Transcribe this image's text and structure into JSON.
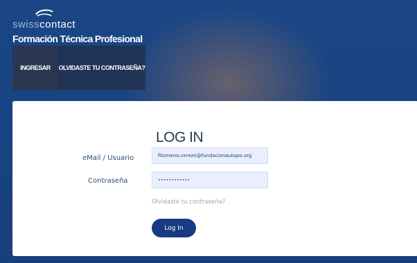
{
  "brand": {
    "logo_light": "swiss",
    "logo_bold": "contact",
    "subtitle": "Formación Técnica Profesional"
  },
  "nav": {
    "items": [
      {
        "label": "INGRESAR"
      },
      {
        "label": "OLVIDASTE TU CONTRASEÑA?"
      }
    ]
  },
  "login": {
    "title": "LOG IN",
    "email_label": "eMail / Usuario",
    "email_value": "filomeno.cerezo@fundacionautapo.org",
    "password_label": "Contraseña",
    "password_value": "••••••••••••",
    "forgot_link": "Olvidaste tu contraseña?",
    "submit_label": "Log In"
  },
  "colors": {
    "header_bg": "#17407e",
    "button_bg": "#173a82",
    "input_bg": "#e9efff"
  }
}
